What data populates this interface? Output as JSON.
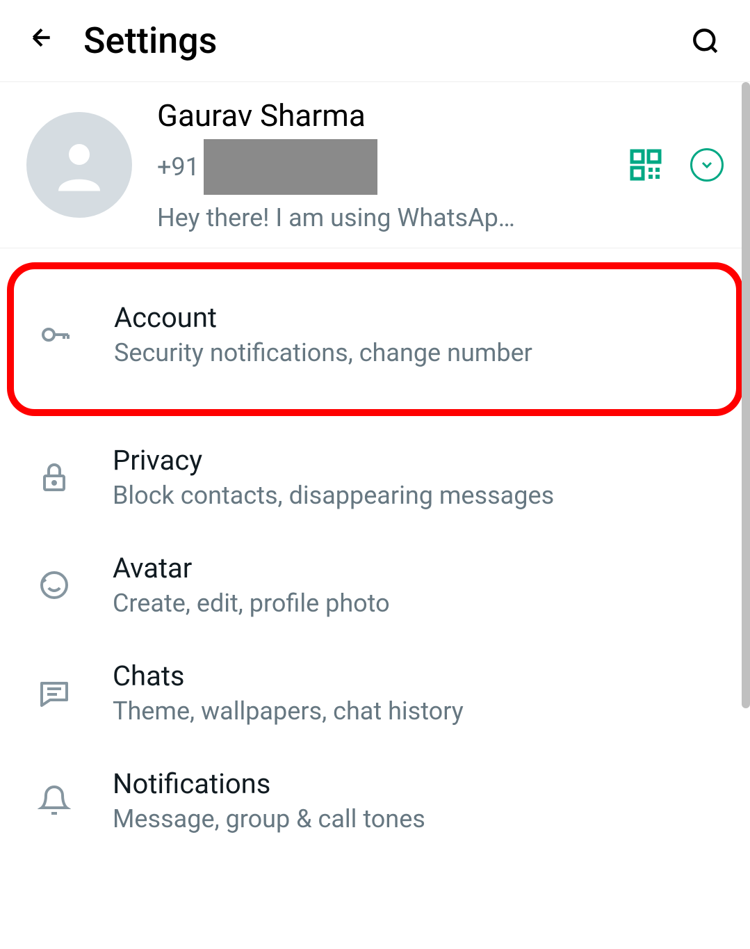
{
  "header": {
    "title": "Settings"
  },
  "profile": {
    "name": "Gaurav Sharma",
    "phone_prefix": "+91",
    "status": "Hey there! I am using WhatsAp…"
  },
  "settings": [
    {
      "title": "Account",
      "subtitle": "Security notifications, change number",
      "icon": "key-icon",
      "highlighted": true
    },
    {
      "title": "Privacy",
      "subtitle": "Block contacts, disappearing messages",
      "icon": "lock-icon",
      "highlighted": false
    },
    {
      "title": "Avatar",
      "subtitle": "Create, edit, profile photo",
      "icon": "avatar-icon",
      "highlighted": false
    },
    {
      "title": "Chats",
      "subtitle": "Theme, wallpapers, chat history",
      "icon": "chat-icon",
      "highlighted": false
    },
    {
      "title": "Notifications",
      "subtitle": "Message, group & call tones",
      "icon": "bell-icon",
      "highlighted": false
    }
  ],
  "colors": {
    "accent": "#00a884",
    "highlight": "#ff0000"
  }
}
